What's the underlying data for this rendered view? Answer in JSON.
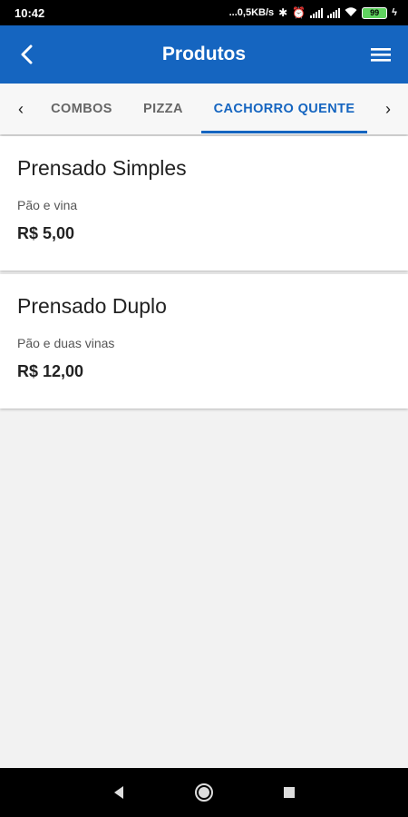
{
  "status_bar": {
    "time": "10:42",
    "network_speed": "...0,5KB/s",
    "battery_level": "99",
    "icons": [
      "bluetooth-off-icon",
      "alarm-icon",
      "signal-icon",
      "signal-icon",
      "wifi-icon",
      "battery-icon",
      "charging-icon"
    ]
  },
  "app_bar": {
    "title": "Produtos",
    "back_icon": "arrow-back-icon",
    "menu_icon": "hamburger-menu-icon",
    "color": "#1565c0"
  },
  "tabs": {
    "items": [
      {
        "label": "COMBOS",
        "active": false
      },
      {
        "label": "PIZZA",
        "active": false
      },
      {
        "label": "CACHORRO QUENTE",
        "active": true
      }
    ],
    "accent": "#1565c0"
  },
  "products": [
    {
      "name": "Prensado Simples",
      "description": "Pão e vina",
      "price": "R$ 5,00"
    },
    {
      "name": "Prensado Duplo",
      "description": "Pão e duas vinas",
      "price": "R$ 12,00"
    }
  ],
  "nav_bar": {
    "icons": [
      "back-triangle-icon",
      "home-circle-icon",
      "recents-square-icon"
    ]
  }
}
